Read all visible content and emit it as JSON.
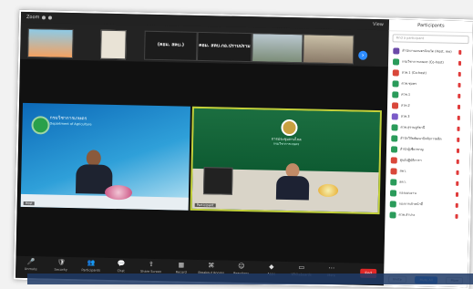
{
  "window": {
    "title": "Zoom",
    "view_label": "View"
  },
  "gallery_strip": [
    {
      "name": "Dashboard 1",
      "caption": ""
    },
    {
      "name": "participant",
      "caption": ""
    },
    {
      "name": "panel",
      "caption": "(คอม. สคบ.)"
    },
    {
      "name": "panel",
      "caption": "คอม. สคบ.กอ.ปราบปราม"
    },
    {
      "name": "meeting room",
      "caption": ""
    },
    {
      "name": "participant",
      "caption": ""
    }
  ],
  "videos": {
    "left": {
      "header": "กรมวิชาการเกษตร",
      "sub": "Department of Agriculture",
      "name": "Host"
    },
    "right": {
      "header": "การประชุมทางไกล",
      "sub": "กรมวิชาการเกษตร",
      "name": "Participant"
    }
  },
  "toolbar": [
    {
      "icon": "mic-icon",
      "glyph": "🎤",
      "label": "Unmute"
    },
    {
      "icon": "security-icon",
      "glyph": "🛡",
      "label": "Security"
    },
    {
      "icon": "participants-icon",
      "glyph": "👥",
      "label": "Participants"
    },
    {
      "icon": "chat-icon",
      "glyph": "💬",
      "label": "Chat"
    },
    {
      "icon": "share-screen-icon",
      "glyph": "⇪",
      "label": "Share Screen"
    },
    {
      "icon": "polls-icon",
      "glyph": "▦",
      "label": "Record"
    },
    {
      "icon": "breakout-icon",
      "glyph": "⌘",
      "label": "Breakout Rooms"
    },
    {
      "icon": "reactions-icon",
      "glyph": "☺",
      "label": "Reactions"
    },
    {
      "icon": "apps-icon",
      "glyph": "◆",
      "label": "Apps"
    },
    {
      "icon": "whiteboard-icon",
      "glyph": "▭",
      "label": "Whiteboards"
    },
    {
      "icon": "more-icon",
      "glyph": "⋯",
      "label": "More"
    }
  ],
  "end_label": "End",
  "participants_panel": {
    "title": "Participants",
    "search_placeholder": "Find a participant",
    "items": [
      {
        "name": "สำนักงานเกษตรจังหวัด (Host, me)",
        "color": "#6b4aa8"
      },
      {
        "name": "กรมวิชาการเกษตร (Co-host)",
        "color": "#2a9b5a"
      },
      {
        "name": "สวพ.1 (Co-host)",
        "color": "#d9473a"
      },
      {
        "name": "ศวพ.ชุมพร",
        "color": "#2a9b5a"
      },
      {
        "name": "ศวพ.1",
        "color": "#2a9b5a"
      },
      {
        "name": "สวพ.2",
        "color": "#d9473a"
      },
      {
        "name": "สวพ.3",
        "color": "#7b5bc8"
      },
      {
        "name": "ศวพ.สุราษฎร์ธานี",
        "color": "#2a9b5a"
      },
      {
        "name": "สำนักวิจัยพัฒนาปัจจัยการผลิต",
        "color": "#2a9b5a"
      },
      {
        "name": "สำนักผู้เชี่ยวชาญ",
        "color": "#2a9b5a"
      },
      {
        "name": "ศูนย์ปฏิบัติการฯ",
        "color": "#d9473a"
      },
      {
        "name": "สพว.",
        "color": "#d9473a"
      },
      {
        "name": "สคว.",
        "color": "#2a9b5a"
      },
      {
        "name": "กองแผนงาน",
        "color": "#2a9b5a"
      },
      {
        "name": "กองการเจ้าหน้าที่",
        "color": "#2a9b5a"
      },
      {
        "name": "ศวพ.ลำปาง",
        "color": "#2a9b5a"
      }
    ],
    "invite_label": "Invite",
    "mute_all_label": "Mute All",
    "more_label": "More"
  }
}
